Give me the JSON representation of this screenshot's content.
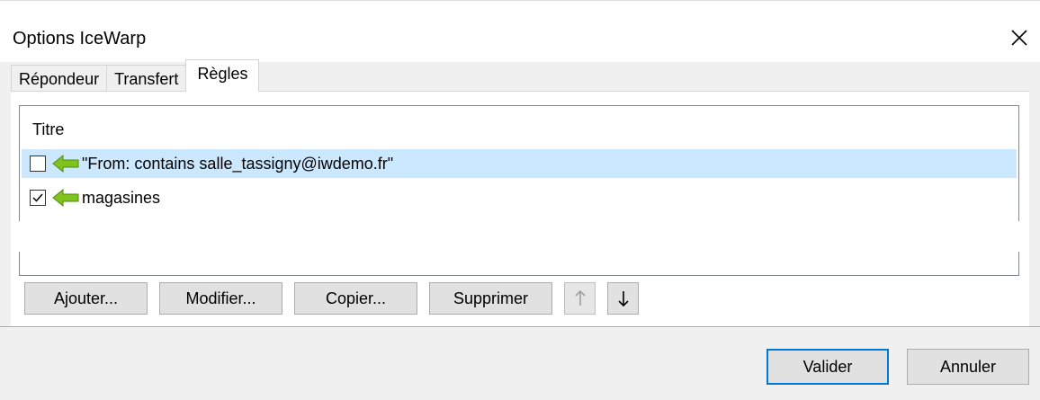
{
  "window": {
    "title": "Options IceWarp"
  },
  "tabs": [
    {
      "label": "Répondeur",
      "active": false
    },
    {
      "label": "Transfert",
      "active": false
    },
    {
      "label": "Règles",
      "active": true
    }
  ],
  "rules_list": {
    "column_header": "Titre",
    "rows": [
      {
        "label": "\"From: contains salle_tassigny@iwdemo.fr\"",
        "checked": false,
        "selected": true,
        "icon": "green-arrow-left-icon"
      },
      {
        "label": "magasines",
        "checked": true,
        "selected": false,
        "icon": "green-arrow-left-icon"
      }
    ]
  },
  "buttons": {
    "add": "Ajouter...",
    "edit": "Modifier...",
    "copy": "Copier...",
    "delete": "Supprimer",
    "move_up": "move-up-arrow-icon",
    "move_down": "move-down-arrow-icon"
  },
  "footer": {
    "ok": "Valider",
    "cancel": "Annuler"
  },
  "colors": {
    "selection": "#cce8ff",
    "arrow_green": "#7fc31c",
    "default_button_border": "#0078d7"
  }
}
